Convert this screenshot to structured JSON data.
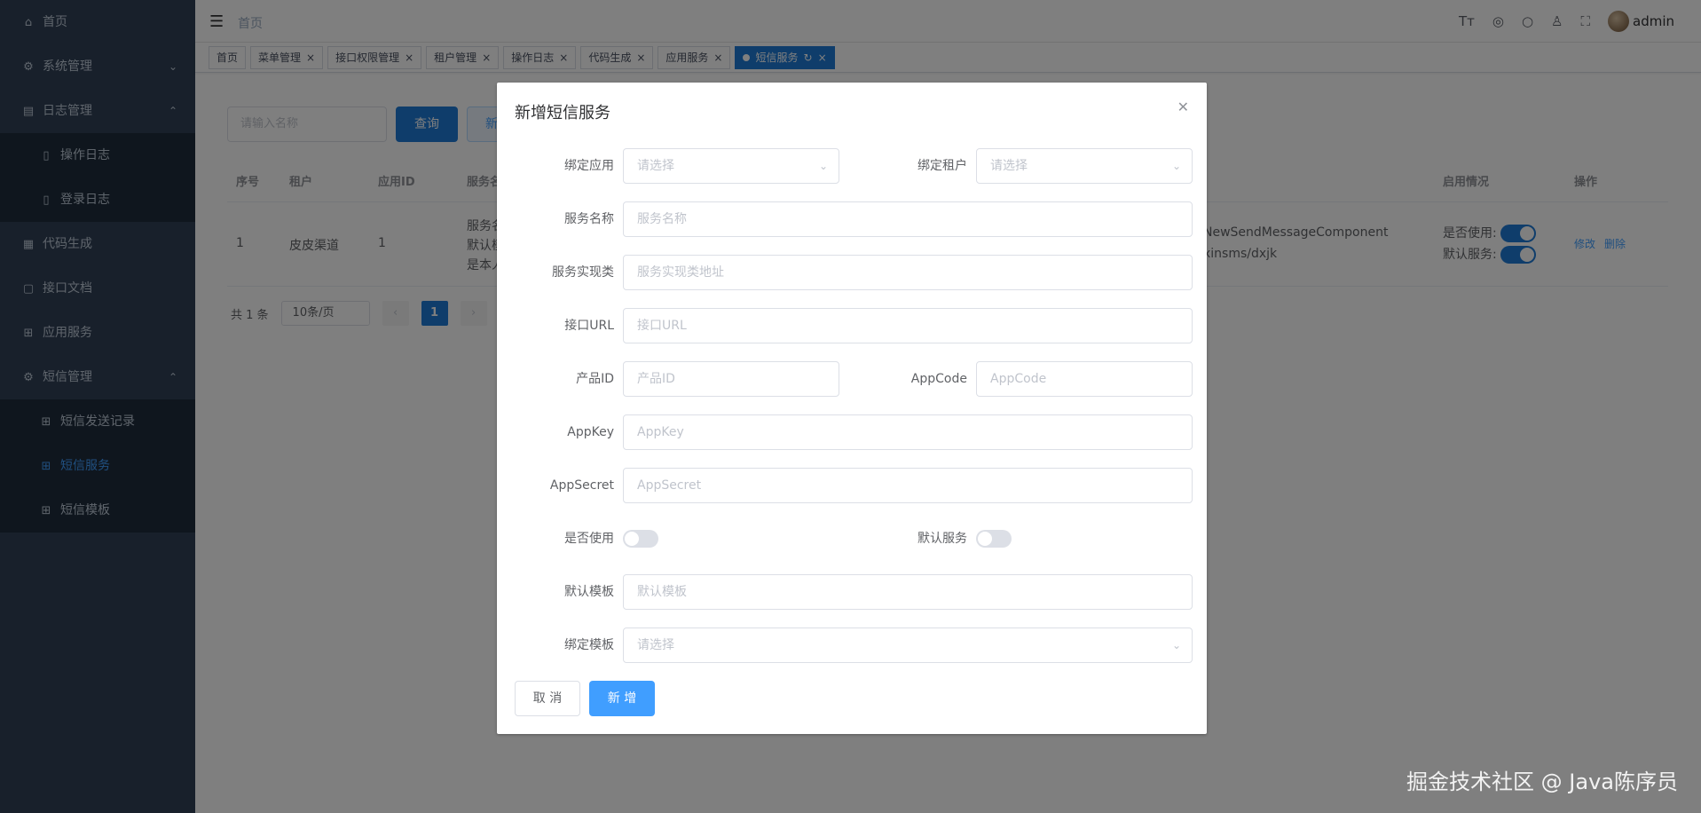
{
  "sidebar": {
    "items": [
      {
        "label": "首页",
        "icon": "home-icon"
      },
      {
        "label": "系统管理",
        "icon": "gear-icon",
        "arrow": "chevron-down"
      },
      {
        "label": "日志管理",
        "icon": "log-icon",
        "arrow": "chevron-up"
      },
      {
        "label": "操作日志",
        "icon": "doc-icon",
        "sub": true
      },
      {
        "label": "登录日志",
        "icon": "doc-icon",
        "sub": true
      },
      {
        "label": "代码生成",
        "icon": "code-icon"
      },
      {
        "label": "接口文档",
        "icon": "api-doc-icon"
      },
      {
        "label": "应用服务",
        "icon": "apps-icon"
      },
      {
        "label": "短信管理",
        "icon": "gear-icon",
        "arrow": "chevron-up"
      },
      {
        "label": "短信发送记录",
        "icon": "apps-icon",
        "sub": true
      },
      {
        "label": "短信服务",
        "icon": "apps-icon",
        "sub": true,
        "active": true
      },
      {
        "label": "短信模板",
        "icon": "apps-icon",
        "sub": true
      }
    ]
  },
  "navbar": {
    "breadcrumb": "首页",
    "user": "admin"
  },
  "tags": [
    {
      "label": "首页",
      "closable": false
    },
    {
      "label": "菜单管理",
      "closable": true
    },
    {
      "label": "接口权限管理",
      "closable": true
    },
    {
      "label": "租户管理",
      "closable": true
    },
    {
      "label": "操作日志",
      "closable": true
    },
    {
      "label": "代码生成",
      "closable": true
    },
    {
      "label": "应用服务",
      "closable": true
    },
    {
      "label": "短信服务",
      "closable": true,
      "active": true
    }
  ],
  "page": {
    "search_placeholder": "请输入名称",
    "query_label": "查询",
    "add_label": "新",
    "table": {
      "headers": [
        "序号",
        "租户",
        "应用ID",
        "服务名",
        "启用情况",
        "操作"
      ],
      "row": {
        "index": "1",
        "tenant": "皮皮渠道",
        "app_id": "1",
        "service_lines": [
          "服务名",
          "默认模",
          "是本人"
        ],
        "impl_lines": [
          "NewSendMessageComponent",
          "xinsms/dxjk"
        ],
        "enabled_label": "是否使用:",
        "default_label": "默认服务:",
        "edit": "修改",
        "delete": "删除"
      }
    },
    "pager": {
      "total": "共 1 条",
      "page_size": "10条/页",
      "current": "1"
    }
  },
  "dialog": {
    "title": "新增短信服务",
    "fields": {
      "bind_app": {
        "label": "绑定应用",
        "placeholder": "请选择"
      },
      "bind_tenant": {
        "label": "绑定租户",
        "placeholder": "请选择"
      },
      "service_name": {
        "label": "服务名称",
        "placeholder": "服务名称"
      },
      "service_impl": {
        "label": "服务实现类",
        "placeholder": "服务实现类地址"
      },
      "api_url": {
        "label": "接口URL",
        "placeholder": "接口URL"
      },
      "product_id": {
        "label": "产品ID",
        "placeholder": "产品ID"
      },
      "app_code": {
        "label": "AppCode",
        "placeholder": "AppCode"
      },
      "app_key": {
        "label": "AppKey",
        "placeholder": "AppKey"
      },
      "app_secret": {
        "label": "AppSecret",
        "placeholder": "AppSecret"
      },
      "is_enabled": {
        "label": "是否使用",
        "value": false
      },
      "is_default": {
        "label": "默认服务",
        "value": false
      },
      "default_template": {
        "label": "默认模板",
        "placeholder": "默认模板"
      },
      "bind_template": {
        "label": "绑定模板",
        "placeholder": "请选择"
      }
    },
    "cancel_label": "取 消",
    "submit_label": "新 增"
  },
  "watermark": "掘金技术社区 @ Java陈序员",
  "colors": {
    "sidebar_bg": "#304156",
    "primary": "#409eff",
    "active_tag": "#1f7bd6"
  }
}
